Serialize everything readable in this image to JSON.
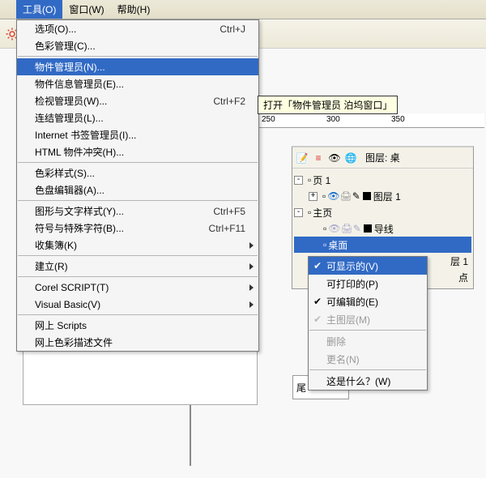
{
  "menubar": {
    "tools": "工具(O)",
    "window": "窗口(W)",
    "help": "帮助(H)"
  },
  "dropdown": {
    "options": {
      "label": "选项(O)...",
      "shortcut": "Ctrl+J"
    },
    "color_mgmt": "色彩管理(C)...",
    "object_manager": "物件管理员(N)...",
    "object_info": "物件信息管理员(E)...",
    "view_mgr": {
      "label": "检视管理员(W)...",
      "shortcut": "Ctrl+F2"
    },
    "link_mgr": "连结管理员(L)...",
    "bookmark_mgr": "Internet 书签管理员(I)...",
    "html_conflict": "HTML 物件冲突(H)...",
    "color_styles": "色彩样式(S)...",
    "palette_editor": "色盘编辑器(A)...",
    "graphic_text": {
      "label": "图形与文字样式(Y)...",
      "shortcut": "Ctrl+F5"
    },
    "symbols": {
      "label": "符号与特殊字符(B)...",
      "shortcut": "Ctrl+F11"
    },
    "scrapbook": "收集簿(K)",
    "create": "建立(R)",
    "corel_script": "Corel SCRIPT(T)",
    "visual_basic": "Visual Basic(V)",
    "web_scripts": "网上 Scripts",
    "web_color_desc": "网上色彩描述文件"
  },
  "tooltip": "打开「物件管理员 泊坞窗口」",
  "ruler": {
    "t250": "250",
    "t300": "300",
    "t350": "350"
  },
  "panel": {
    "layer_label": "图层: 桌",
    "page1": "页 1",
    "layer1": "图层 1",
    "master": "主页",
    "guides": "导线",
    "desktop": "桌面",
    "layer_suffix": "层 1",
    "point_suffix": "点"
  },
  "context": {
    "visible": "可显示的(V)",
    "printable": "可打印的(P)",
    "editable": "可编辑的(E)",
    "master_layer": "主图层(M)",
    "delete": "删除",
    "rename": "更名(N)",
    "whats_this": "这是什么？(W)"
  },
  "bottom": {
    "text": "尾"
  }
}
